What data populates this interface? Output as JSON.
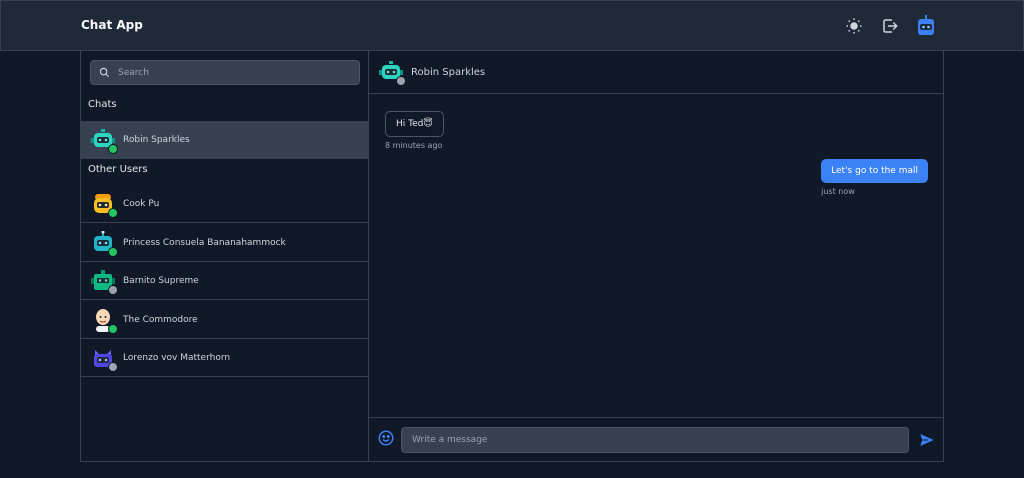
{
  "header": {
    "title": "Chat App"
  },
  "search": {
    "placeholder": "Search"
  },
  "sections": {
    "chats": "Chats",
    "other_users": "Other Users"
  },
  "chats": [
    {
      "name": "Robin Sparkles",
      "status": "online",
      "color": "#22c55e",
      "avatar": "teal-robot"
    }
  ],
  "other_users": [
    {
      "name": "Cook Pu",
      "status": "online",
      "color": "#22c55e",
      "avatar": "yellow-robot"
    },
    {
      "name": "Princess Consuela Bananahammock",
      "status": "online",
      "color": "#22c55e",
      "avatar": "teal-robot"
    },
    {
      "name": "Barnito Supreme",
      "status": "offline",
      "color": "#9ca3af",
      "avatar": "green-robot"
    },
    {
      "name": "The Commodore",
      "status": "online",
      "color": "#22c55e",
      "avatar": "bald-man"
    },
    {
      "name": "Lorenzo vov Matterhorn",
      "status": "offline",
      "color": "#9ca3af",
      "avatar": "indigo-robot"
    }
  ],
  "conversation": {
    "contact": "Robin Sparkles",
    "messages": [
      {
        "direction": "in",
        "text": "Hi Ted😇",
        "time": "8 minutes ago"
      },
      {
        "direction": "out",
        "text": "Let's go to the mall",
        "time": "just now"
      }
    ]
  },
  "composer": {
    "placeholder": "Write a message"
  },
  "colors": {
    "accent": "#3b82f6",
    "online": "#22c55e",
    "offline": "#9ca3af"
  }
}
